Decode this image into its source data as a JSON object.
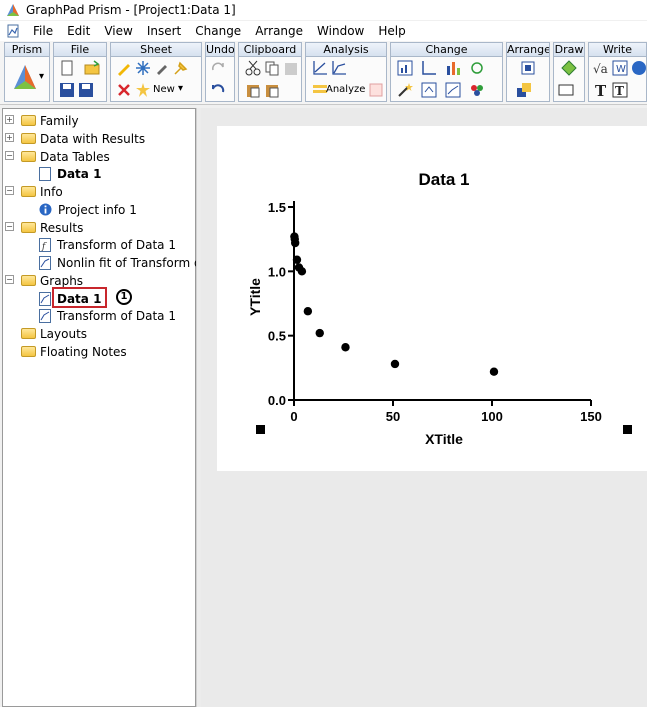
{
  "window": {
    "title": "GraphPad Prism - [Project1:Data 1]"
  },
  "menu": [
    "File",
    "Edit",
    "View",
    "Insert",
    "Change",
    "Arrange",
    "Window",
    "Help"
  ],
  "ribbon": {
    "groups": [
      "Prism",
      "File",
      "Sheet",
      "Undo",
      "Clipboard",
      "Analysis",
      "Change",
      "Arrange",
      "Draw",
      "Write"
    ],
    "new_label": "New",
    "analyze_label": "Analyze"
  },
  "navigator": {
    "items": [
      {
        "label": "Family"
      },
      {
        "label": "Data with Results"
      },
      {
        "label": "Data Tables"
      },
      {
        "label": "Data 1"
      },
      {
        "label": "Info"
      },
      {
        "label": "Project info 1"
      },
      {
        "label": "Results"
      },
      {
        "label": "Transform of Data 1"
      },
      {
        "label": "Nonlin fit of Transform of"
      },
      {
        "label": "Graphs"
      },
      {
        "label": "Data 1"
      },
      {
        "label": "Transform of Data 1"
      },
      {
        "label": "Layouts"
      },
      {
        "label": "Floating Notes"
      }
    ],
    "callout": "1"
  },
  "chart_data": {
    "type": "scatter",
    "title": "Data 1",
    "xlabel": "XTitle",
    "ylabel": "YTitle",
    "xlim": [
      0,
      150
    ],
    "ylim": [
      0,
      1.5
    ],
    "xticks": [
      "0",
      "50",
      "100",
      "150"
    ],
    "yticks": [
      "0.0",
      "0.5",
      "1.0",
      "1.5"
    ],
    "points": [
      {
        "x": 0.2,
        "y": 1.27
      },
      {
        "x": 0.4,
        "y": 1.25
      },
      {
        "x": 0.6,
        "y": 1.22
      },
      {
        "x": 1.5,
        "y": 1.09
      },
      {
        "x": 2.5,
        "y": 1.03
      },
      {
        "x": 4,
        "y": 1.0
      },
      {
        "x": 7,
        "y": 0.69
      },
      {
        "x": 13,
        "y": 0.52
      },
      {
        "x": 26,
        "y": 0.41
      },
      {
        "x": 51,
        "y": 0.28
      },
      {
        "x": 101,
        "y": 0.22
      }
    ]
  }
}
